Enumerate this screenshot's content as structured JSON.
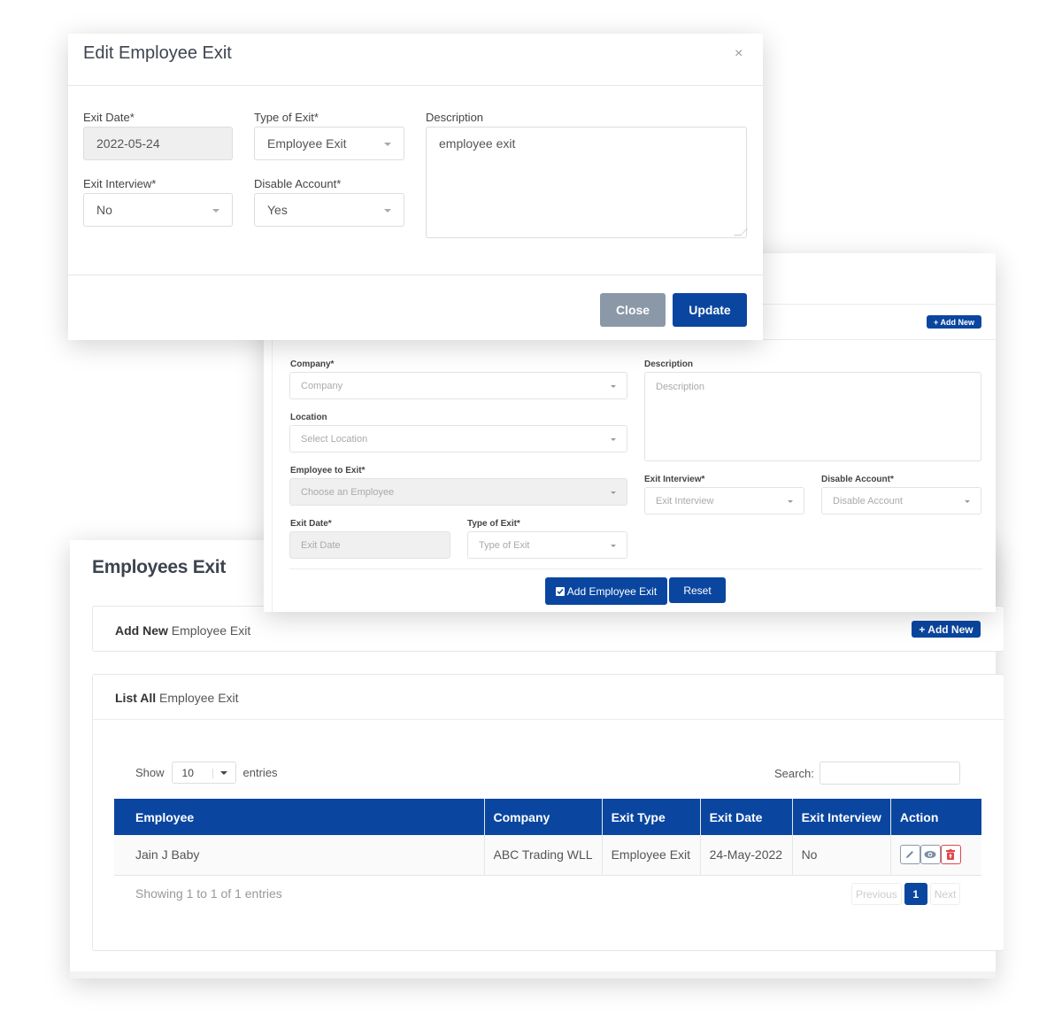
{
  "page": {
    "title": "Employees Exit",
    "add_card": {
      "bold": "Add New",
      "rest": " Employee Exit",
      "button": "+ Add New"
    },
    "list_card": {
      "bold": "List All",
      "rest": " Employee Exit"
    },
    "table_controls": {
      "show_label": "Show",
      "length_value": "10",
      "entries_label": "entries",
      "search_label": "Search:",
      "search_value": ""
    },
    "table": {
      "columns": [
        "Employee",
        "Company",
        "Exit Type",
        "Exit Date",
        "Exit Interview",
        "Action"
      ],
      "rows": [
        {
          "employee": "Jain J Baby",
          "company": "ABC Trading WLL",
          "exit_type": "Employee Exit",
          "exit_date": "24-May-2022",
          "exit_interview": "No",
          "actions": [
            "edit-icon",
            "view-icon",
            "delete-icon"
          ]
        }
      ]
    },
    "info": "Showing 1 to 1 of 1 entries",
    "pagination": {
      "previous": "Previous",
      "current": "1",
      "next": "Next"
    }
  },
  "add_form": {
    "add_new_button": "+ Add New",
    "fields": {
      "company": {
        "label": "Company*",
        "placeholder": "Company"
      },
      "location": {
        "label": "Location",
        "placeholder": "Select Location"
      },
      "employee": {
        "label": "Employee to Exit*",
        "placeholder": "Choose an Employee"
      },
      "exit_date": {
        "label": "Exit Date*",
        "placeholder": "Exit Date"
      },
      "type_of_exit": {
        "label": "Type of Exit*",
        "placeholder": "Type of Exit"
      },
      "description": {
        "label": "Description",
        "placeholder": "Description"
      },
      "exit_interview": {
        "label": "Exit Interview*",
        "placeholder": "Exit Interview"
      },
      "disable_account": {
        "label": "Disable Account*",
        "placeholder": "Disable Account"
      }
    },
    "submit_button": "Add Employee Exit",
    "reset_button": "Reset"
  },
  "modal": {
    "title": "Edit Employee Exit",
    "close_icon": "×",
    "fields": {
      "exit_date": {
        "label": "Exit Date*",
        "value": "2022-05-24"
      },
      "type_of_exit": {
        "label": "Type of Exit*",
        "value": "Employee Exit"
      },
      "exit_interview": {
        "label": "Exit Interview*",
        "value": "No"
      },
      "disable_account": {
        "label": "Disable Account*",
        "value": "Yes"
      },
      "description": {
        "label": "Description",
        "value": "employee exit"
      }
    },
    "close_button": "Close",
    "update_button": "Update"
  },
  "colors": {
    "primary": "#0a46a0",
    "secondary": "#8a98a8",
    "danger": "#e0464b"
  }
}
